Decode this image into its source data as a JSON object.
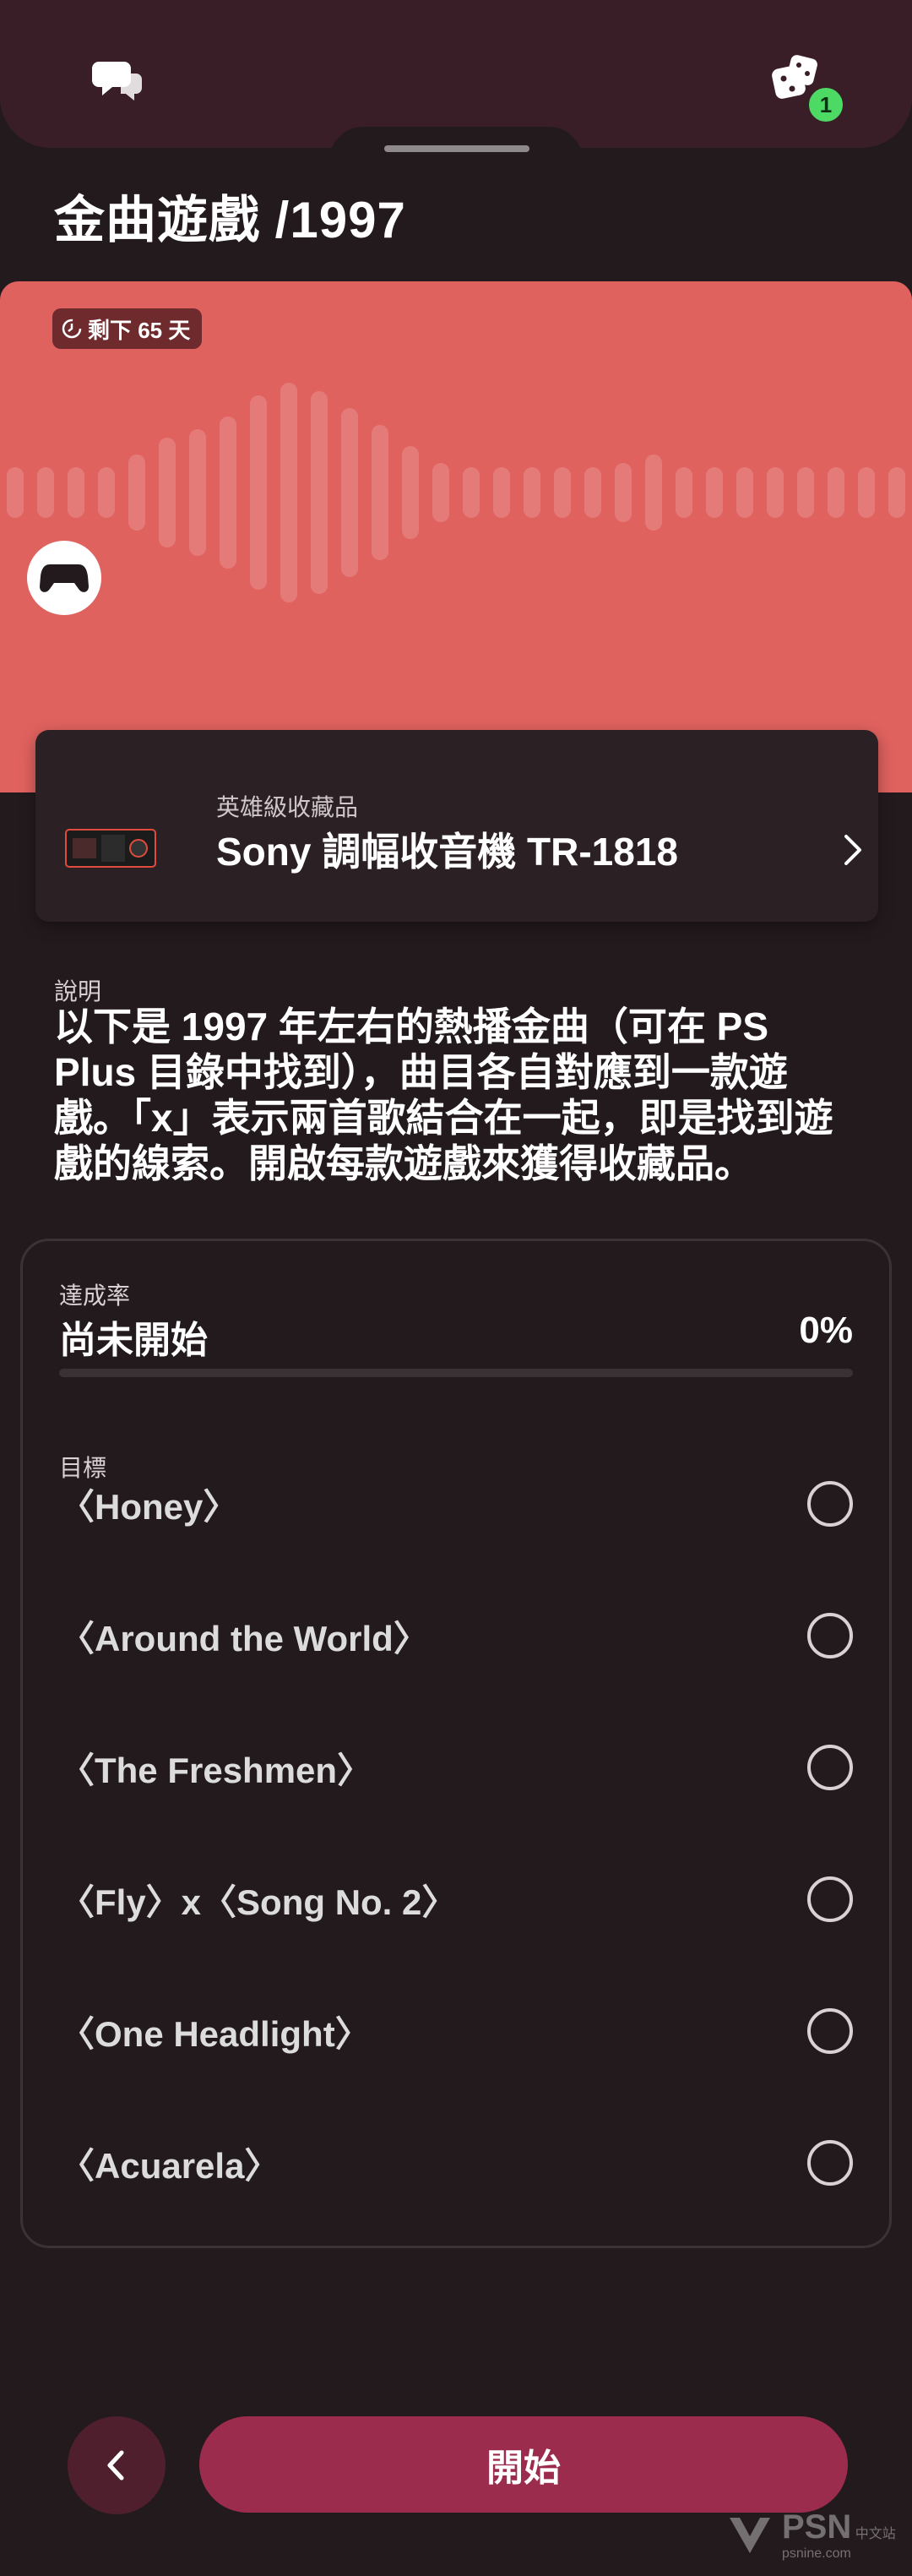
{
  "top_bar": {
    "notification_count": "1"
  },
  "page": {
    "title": "金曲遊戲 /1997"
  },
  "hero": {
    "timer_text": "剩下 65 天",
    "color": "#e0625f"
  },
  "reward": {
    "tier": "英雄級收藏品",
    "name": "Sony 調幅收音機 TR-1818"
  },
  "description": {
    "label": "說明",
    "text": "以下是 1997 年左右的熱播金曲（可在 PS Plus 目錄中找到），曲目各自對應到一款遊戲。「x」表示兩首歌結合在一起，即是找到遊戲的線索。開啟每款遊戲來獲得收藏品。"
  },
  "progress": {
    "label": "達成率",
    "status": "尚未開始",
    "value_text": "0%",
    "fraction": 0.0
  },
  "goals": {
    "label": "目標",
    "items": [
      {
        "text": "〈Honey〉",
        "done": false
      },
      {
        "text": "〈Around the World〉",
        "done": false
      },
      {
        "text": "〈The Freshmen〉",
        "done": false
      },
      {
        "text": "〈Fly〉x〈Song No. 2〉",
        "done": false
      },
      {
        "text": "〈One Headlight〉",
        "done": false
      },
      {
        "text": "〈Acuarela〉",
        "done": false
      }
    ]
  },
  "actions": {
    "start_label": "開始"
  },
  "watermark": {
    "brand": "PSN",
    "sub": "psnine.com",
    "tag": "中文站"
  },
  "colors": {
    "accent": "#9c2c4d",
    "badge": "#4cd964",
    "background": "#231a1d"
  }
}
